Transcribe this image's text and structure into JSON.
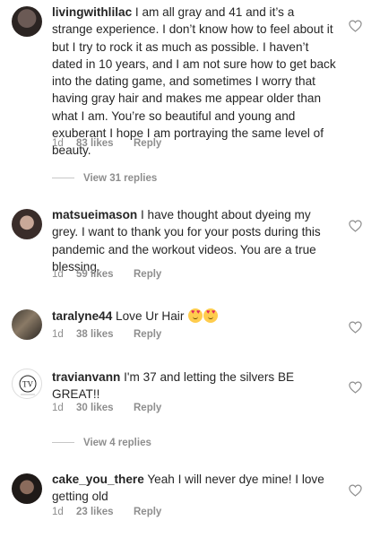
{
  "comments": [
    {
      "username": "livingwithlilac",
      "text": "I am all gray and 41 and it’s a strange experience. I don’t know how to feel about it but I try to rock it as much as possible. I haven’t dated in 10 years, and I am not sure how to get back into the dating game, and sometimes I worry that having gray hair and makes me appear older than what I am. You’re so beautiful and young and exuberant I hope I am portraying the same level of beauty.",
      "time": "1d",
      "likes": "83 likes",
      "reply": "Reply"
    },
    {
      "username": "matsueimason",
      "text": "I have thought about dyeing my grey. I want to thank you for your posts during this pandemic and the workout videos. You are a true blessing.",
      "time": "1d",
      "likes": "59 likes",
      "reply": "Reply"
    },
    {
      "username": "taralyne44",
      "text": "Love Ur Hair",
      "emoji": [
        "heart-eyes-emoji",
        "heart-eyes-emoji"
      ],
      "time": "1d",
      "likes": "38 likes",
      "reply": "Reply"
    },
    {
      "username": "travianvann",
      "text": "I'm 37 and letting the silvers BE GREAT!!",
      "avatar_logo_text": "TV",
      "time": "1d",
      "likes": "30 likes",
      "reply": "Reply"
    },
    {
      "username": "cake_you_there",
      "text": "Yeah I will never dye mine! I love getting old",
      "time": "1d",
      "likes": "23 likes",
      "reply": "Reply"
    }
  ],
  "view_replies": [
    {
      "label": "View 31 replies"
    },
    {
      "label": "View 4 replies"
    }
  ],
  "icons": {
    "like": "heart-outline-icon"
  },
  "colors": {
    "text": "#262626",
    "meta": "#8e8e8e",
    "divider": "#c7c7c7"
  }
}
